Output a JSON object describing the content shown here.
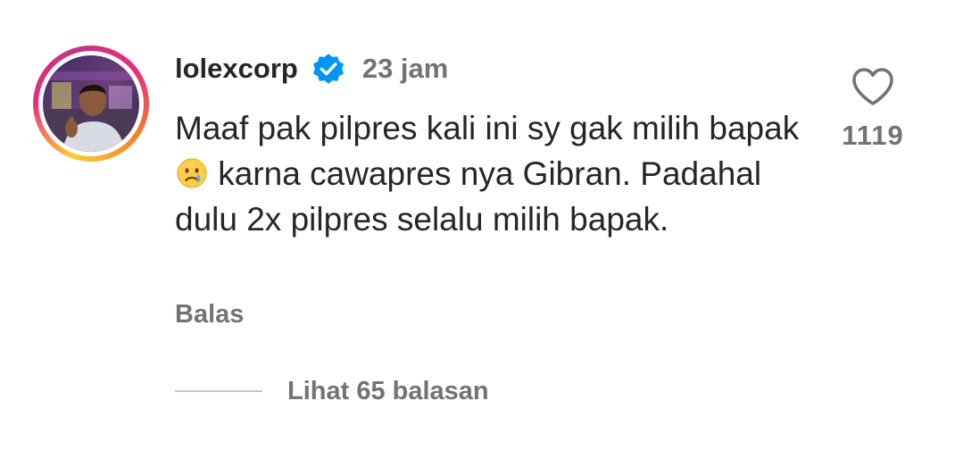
{
  "comment": {
    "username": "lolexcorp",
    "verified": true,
    "timestamp": "23 jam",
    "text_part1": "Maaf pak pilpres kali ini sy gak milih bapak",
    "emoji": "crying-face-emoji",
    "text_part2": " karna cawapres nya Gibran. Padahal dulu 2x pilpres selalu milih bapak.",
    "reply_label": "Balas",
    "view_replies_label": "Lihat 65 balasan",
    "like_count": "1119"
  },
  "icons": {
    "verified": "verified-badge-icon",
    "like": "heart-outline-icon"
  },
  "colors": {
    "primary_text": "#262626",
    "secondary_text": "#737373",
    "verified_blue": "#0095f6",
    "divider": "#c7c7c7"
  }
}
